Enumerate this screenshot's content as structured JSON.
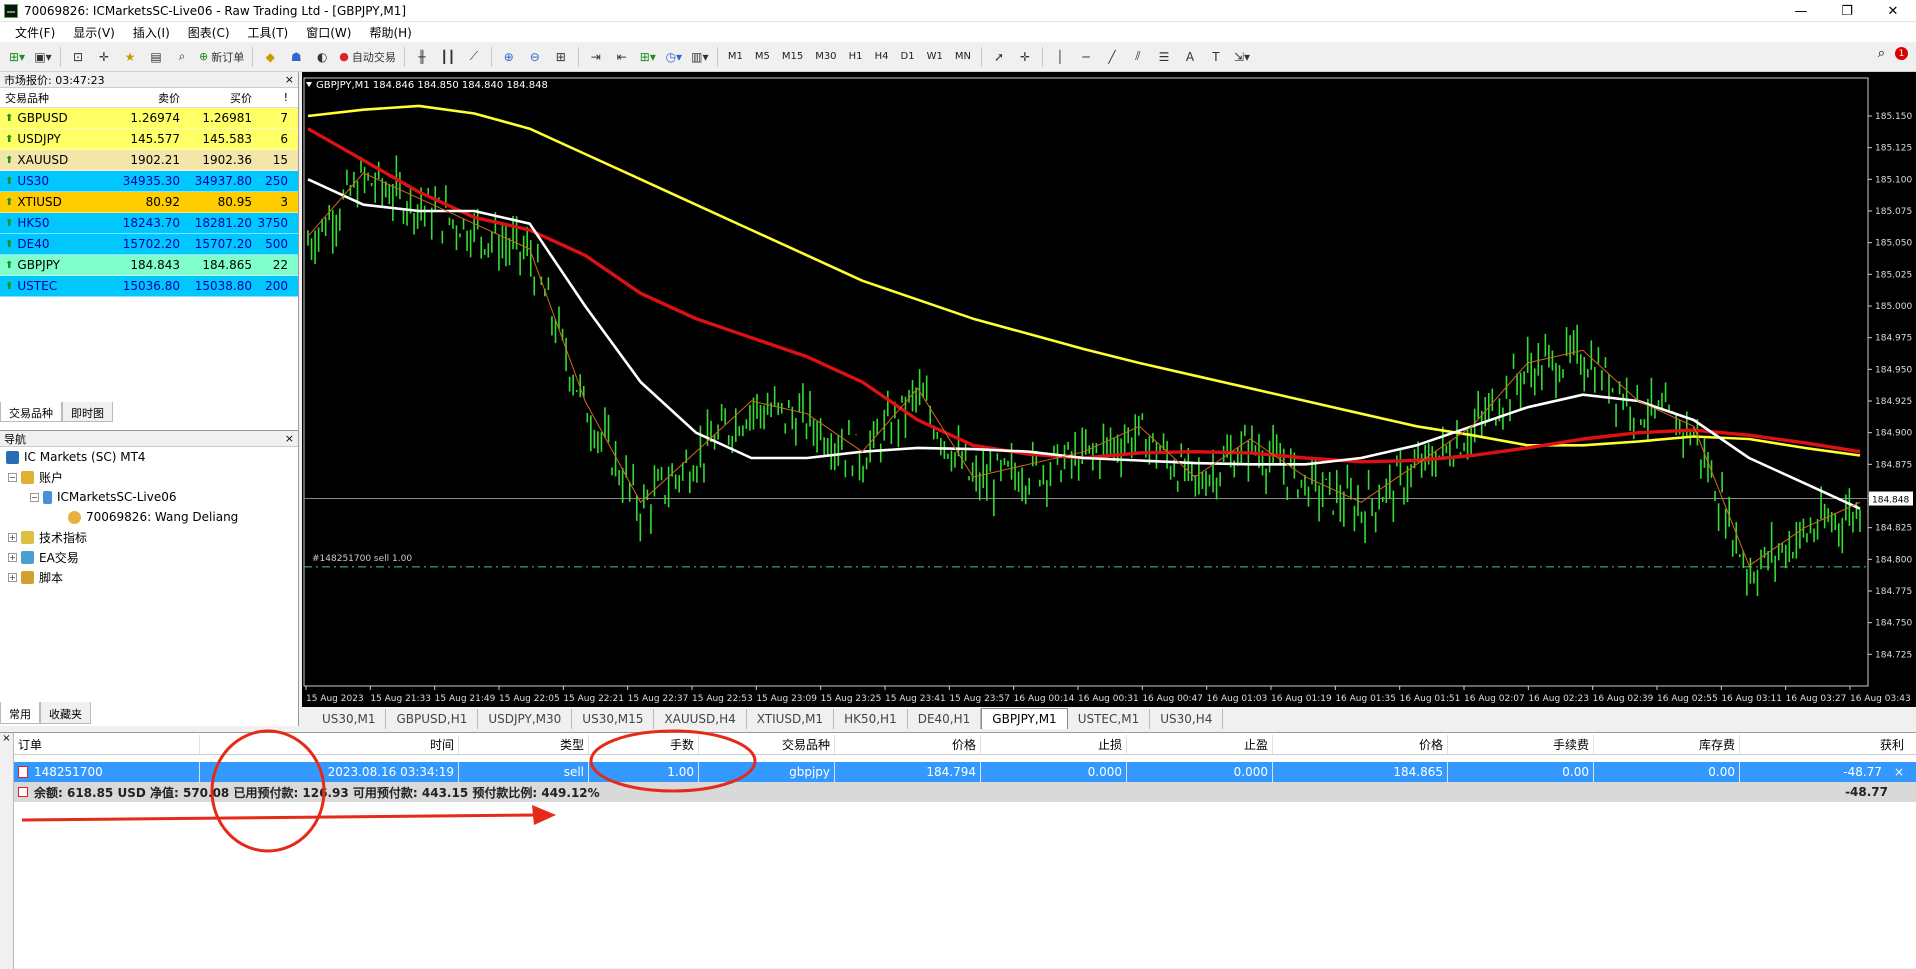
{
  "window": {
    "title": "70069826: ICMarketsSC-Live06 - Raw Trading Ltd - [GBPJPY,M1]",
    "min": "—",
    "max": "❐",
    "close": "✕"
  },
  "menu": [
    "文件(F)",
    "显示(V)",
    "插入(I)",
    "图表(C)",
    "工具(T)",
    "窗口(W)",
    "帮助(H)"
  ],
  "toolbar": {
    "new_order": "新订单",
    "auto_trading": "自动交易",
    "timeframes": [
      "M1",
      "M5",
      "M15",
      "M30",
      "H1",
      "H4",
      "D1",
      "W1",
      "MN"
    ],
    "notification_count": "1"
  },
  "market_watch": {
    "title": "市场报价: 03:47:23",
    "headers": {
      "symbol": "交易品种",
      "bid": "卖价",
      "ask": "买价",
      "spread": "!"
    },
    "rows": [
      {
        "symbol": "GBPUSD",
        "bid": "1.26974",
        "ask": "1.26981",
        "spread": "7",
        "bg": "#ffff66",
        "color": "#000"
      },
      {
        "symbol": "USDJPY",
        "bid": "145.577",
        "ask": "145.583",
        "spread": "6",
        "bg": "#ffff66",
        "color": "#000"
      },
      {
        "symbol": "XAUUSD",
        "bid": "1902.21",
        "ask": "1902.36",
        "spread": "15",
        "bg": "#f3e6a8",
        "color": "#000"
      },
      {
        "symbol": "US30",
        "bid": "34935.30",
        "ask": "34937.80",
        "spread": "250",
        "bg": "#00c8ff",
        "color": "#0000aa"
      },
      {
        "symbol": "XTIUSD",
        "bid": "80.92",
        "ask": "80.95",
        "spread": "3",
        "bg": "#ffcc00",
        "color": "#000"
      },
      {
        "symbol": "HK50",
        "bid": "18243.70",
        "ask": "18281.20",
        "spread": "3750",
        "bg": "#00c8ff",
        "color": "#0000aa"
      },
      {
        "symbol": "DE40",
        "bid": "15702.20",
        "ask": "15707.20",
        "spread": "500",
        "bg": "#00c8ff",
        "color": "#0000aa"
      },
      {
        "symbol": "GBPJPY",
        "bid": "184.843",
        "ask": "184.865",
        "spread": "22",
        "bg": "#80ffcc",
        "color": "#000"
      },
      {
        "symbol": "USTEC",
        "bid": "15036.80",
        "ask": "15038.80",
        "spread": "200",
        "bg": "#00c8ff",
        "color": "#0000aa"
      }
    ],
    "tabs": [
      "交易品种",
      "即时图"
    ]
  },
  "navigator": {
    "title": "导航",
    "root": "IC Markets (SC) MT4",
    "accounts": "账户",
    "server": "ICMarketsSC-Live06",
    "account": "70069826: Wang Deliang",
    "indicators": "技术指标",
    "ea": "EA交易",
    "scripts": "脚本",
    "tabs": [
      "常用",
      "收藏夹"
    ]
  },
  "chart_data": {
    "type": "line",
    "symbol_header": "GBPJPY,M1  184.846 184.850 184.840 184.848",
    "order_label": "#148251700 sell 1.00",
    "current_price": "184.848",
    "order_price": 184.794,
    "ylim": [
      184.7,
      185.18
    ],
    "yticks": [
      "185.150",
      "185.125",
      "185.100",
      "185.075",
      "185.050",
      "185.025",
      "185.000",
      "184.975",
      "184.950",
      "184.925",
      "184.900",
      "184.875",
      "184.850",
      "184.825",
      "184.800",
      "184.775",
      "184.750",
      "184.725"
    ],
    "xticks": [
      "15 Aug 2023",
      "15 Aug 21:33",
      "15 Aug 21:49",
      "15 Aug 22:05",
      "15 Aug 22:21",
      "15 Aug 22:37",
      "15 Aug 22:53",
      "15 Aug 23:09",
      "15 Aug 23:25",
      "15 Aug 23:41",
      "15 Aug 23:57",
      "16 Aug 00:14",
      "16 Aug 00:31",
      "16 Aug 00:47",
      "16 Aug 01:03",
      "16 Aug 01:19",
      "16 Aug 01:35",
      "16 Aug 01:51",
      "16 Aug 02:07",
      "16 Aug 02:23",
      "16 Aug 02:39",
      "16 Aug 02:55",
      "16 Aug 03:11",
      "16 Aug 03:27",
      "16 Aug 03:43"
    ],
    "series": [
      {
        "color": "#ffff33",
        "values": [
          185.15,
          185.155,
          185.158,
          185.152,
          185.14,
          185.12,
          185.1,
          185.08,
          185.06,
          185.04,
          185.02,
          185.005,
          184.99,
          184.978,
          184.966,
          184.955,
          184.945,
          184.935,
          184.925,
          184.915,
          184.905,
          184.898,
          184.89,
          184.89,
          184.893,
          184.897,
          184.895,
          184.888,
          184.882
        ]
      },
      {
        "color": "#dd1111",
        "values": [
          185.14,
          185.115,
          185.09,
          185.07,
          185.06,
          185.04,
          185.01,
          184.99,
          184.975,
          184.96,
          184.94,
          184.91,
          184.89,
          184.883,
          184.88,
          184.884,
          184.885,
          184.884,
          184.88,
          184.877,
          184.878,
          184.882,
          184.888,
          184.895,
          184.9,
          184.902,
          184.898,
          184.892,
          184.885
        ]
      },
      {
        "color": "#ffffff",
        "values": [
          185.1,
          185.08,
          185.075,
          185.075,
          185.065,
          185.0,
          184.94,
          184.9,
          184.88,
          184.88,
          184.885,
          184.888,
          184.887,
          184.885,
          184.88,
          184.878,
          184.876,
          184.875,
          184.875,
          184.88,
          184.89,
          184.905,
          184.92,
          184.93,
          184.925,
          184.91,
          184.88,
          184.86,
          184.84
        ]
      },
      {
        "color": "#55ff55",
        "values": [
          185.05,
          185.1,
          185.08,
          185.06,
          185.04,
          184.92,
          184.84,
          184.88,
          184.92,
          184.91,
          184.88,
          184.93,
          184.86,
          184.87,
          184.88,
          184.9,
          184.86,
          184.89,
          184.86,
          184.84,
          184.87,
          184.9,
          184.95,
          184.96,
          184.92,
          184.9,
          184.79,
          184.82,
          184.84
        ]
      }
    ]
  },
  "chart_tabs": [
    "US30,M1",
    "GBPUSD,H1",
    "USDJPY,M30",
    "US30,M15",
    "XAUUSD,H4",
    "XTIUSD,M1",
    "HK50,H1",
    "DE40,H1",
    "GBPJPY,M1",
    "USTEC,M1",
    "US30,H4"
  ],
  "terminal": {
    "headers": [
      "订单",
      "时间",
      "类型",
      "手数",
      "交易品种",
      "价格",
      "止损",
      "止盈",
      "价格",
      "手续费",
      "库存费",
      "获利"
    ],
    "row": [
      "148251700",
      "2023.08.16 03:34:19",
      "sell",
      "1.00",
      "gbpjpy",
      "184.794",
      "0.000",
      "0.000",
      "184.865",
      "0.00",
      "0.00",
      "-48.77"
    ],
    "balance_line": "余额: 618.85 USD  净值: 570.08  已用预付款: 126.93  可用预付款: 443.15  预付款比例: 449.12%",
    "balance_profit": "-48.77"
  }
}
